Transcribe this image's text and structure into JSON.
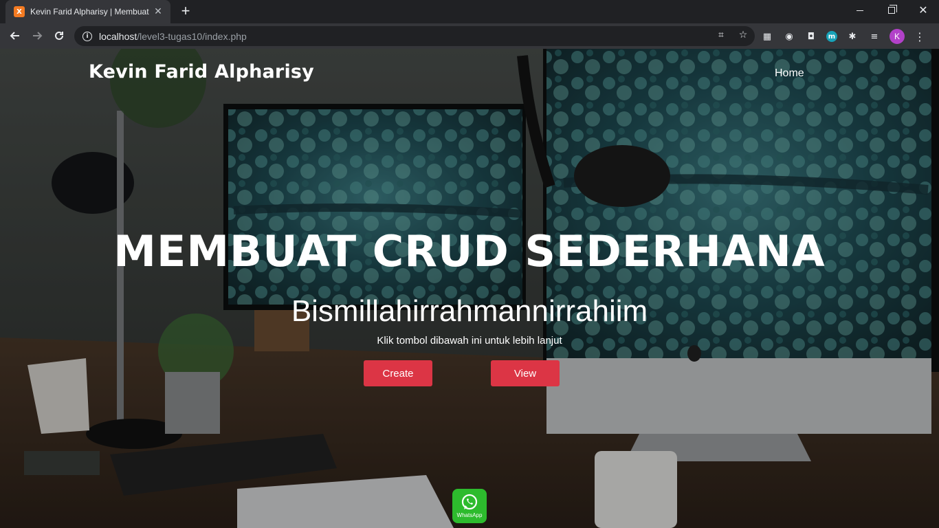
{
  "browser": {
    "tab_title": "Kevin Farid Alpharisy | Membuat CRUD Sederhana",
    "favicon_text": "X",
    "new_tab": "+",
    "url_host": "localhost",
    "url_path": "/level3-tugas10/index.php",
    "profile_initial": "K",
    "extension_m": "m"
  },
  "nav": {
    "brand": "Kevin Farid Alpharisy",
    "home": "Home"
  },
  "hero": {
    "title": "MEMBUAT CRUD SEDERHANA",
    "subtitle": "Bismillahirrahmannirrahiim",
    "note": "Klik tombol dibawah ini untuk lebih lanjut",
    "create_label": "Create",
    "view_label": "View"
  },
  "whatsapp": {
    "label": "WhatsApp"
  },
  "colors": {
    "accent": "#dc3545",
    "whatsapp": "#2dbb2d",
    "chrome_dark": "#202124",
    "chrome_toolbar": "#35363a"
  }
}
